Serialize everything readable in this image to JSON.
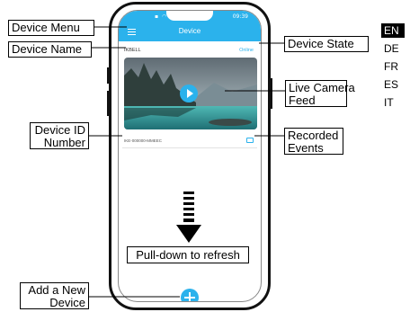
{
  "callouts": {
    "device_menu": "Device Menu",
    "device_name": "Device Name",
    "device_state": "Device State",
    "live_feed_line1": "Live Camera",
    "live_feed_line2": "Feed",
    "device_id_line1": "Device ID",
    "device_id_line2": "Number",
    "recorded_line1": "Recorded",
    "recorded_line2": "Events",
    "refresh": "Pull-down to refresh",
    "add_line1": "Add a New",
    "add_line2": "Device"
  },
  "app": {
    "title": "Device",
    "status_time": "09:39",
    "device_name": "IKBELL",
    "device_state": "Online",
    "device_id": "IKE-000000-MMEEC"
  },
  "languages": [
    {
      "code": "EN",
      "active": true
    },
    {
      "code": "DE",
      "active": false
    },
    {
      "code": "FR",
      "active": false
    },
    {
      "code": "ES",
      "active": false
    },
    {
      "code": "IT",
      "active": false
    }
  ],
  "colors": {
    "accent": "#2bb2ec",
    "outline": "#000000"
  }
}
